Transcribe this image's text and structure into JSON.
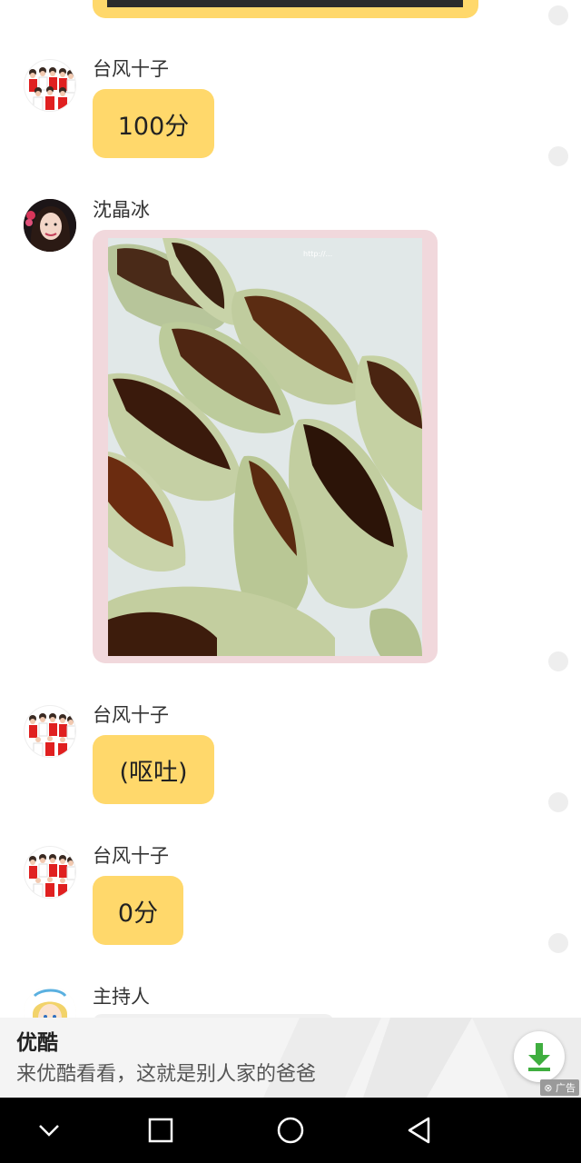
{
  "chat": {
    "messages": [
      {
        "sender": "台风十子",
        "text": "100分"
      },
      {
        "sender": "沈晶冰",
        "text": ""
      },
      {
        "sender": "台风十子",
        "text": "(呕吐)"
      },
      {
        "sender": "台风十子",
        "text": "0分"
      },
      {
        "sender": "主持人",
        "text": ""
      }
    ],
    "image_watermark": "http://..."
  },
  "ad": {
    "title": "优酷",
    "description": "来优酷看看，这就是别人家的爸爸",
    "tag": "广告",
    "button_icon": "download-icon"
  },
  "navbar": {
    "icons": [
      "chevron-down-icon",
      "square-icon",
      "circle-icon",
      "back-triangle-icon"
    ]
  },
  "colors": {
    "bubble": "#ffd86b",
    "photo_frame": "#f1d8dc",
    "ad_button_green": "#3fae3f",
    "navbar": "#000000"
  }
}
